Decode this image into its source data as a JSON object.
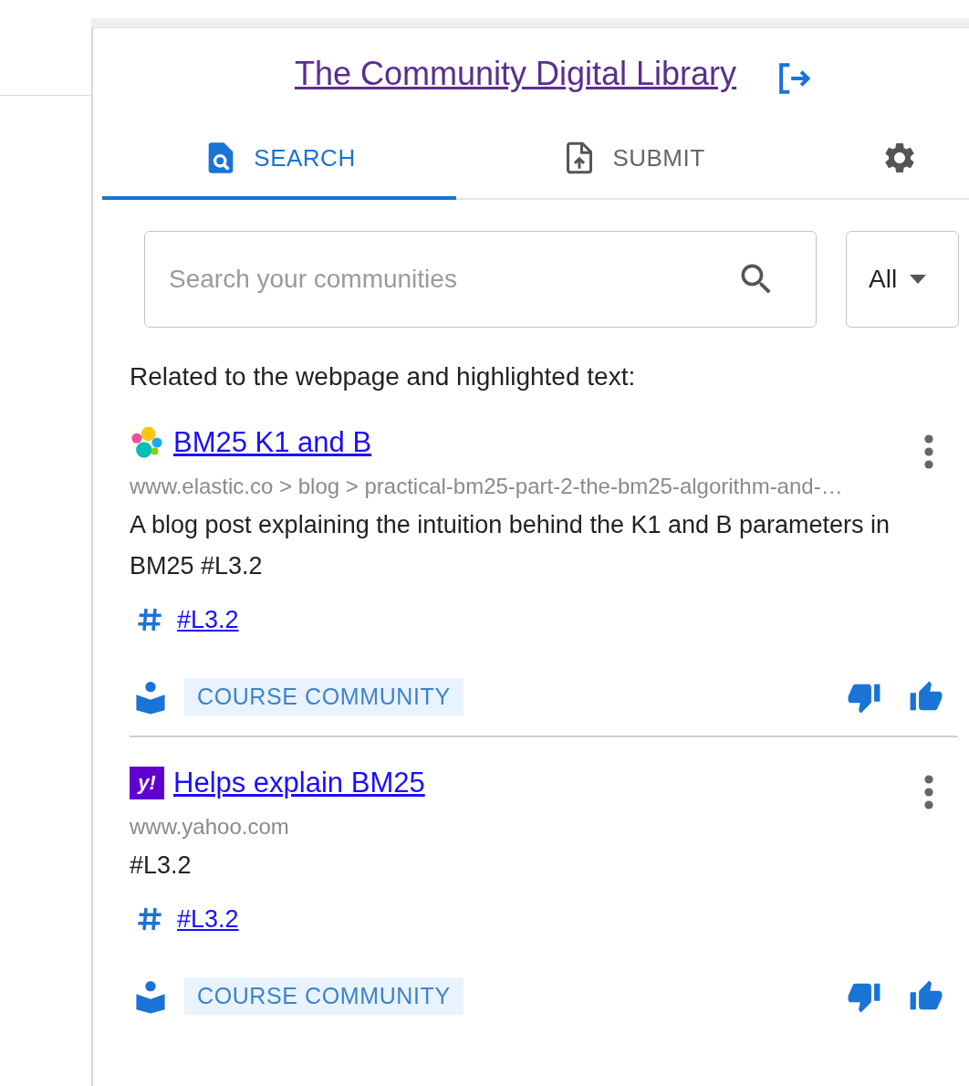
{
  "header": {
    "title": "The Community Digital Library"
  },
  "tabs": [
    {
      "kind": "search",
      "label": "SEARCH",
      "selected": true
    },
    {
      "kind": "submit",
      "label": "SUBMIT",
      "selected": false
    },
    {
      "kind": "settings",
      "selected": false
    }
  ],
  "search": {
    "placeholder": "Search your communities",
    "scope": "All"
  },
  "section_heading": "Related to the webpage and highlighted text:",
  "results": [
    {
      "favicon": {
        "kind": "elastic"
      },
      "title": "BM25 K1 and B",
      "url": "www.elastic.co > blog > practical-bm25-part-2-the-bm25-algorithm-and-…",
      "description": "A blog post explaining the intuition behind the K1 and B parameters in BM25 #L3.2",
      "tags": [
        "#L3.2"
      ],
      "community": "COURSE COMMUNITY"
    },
    {
      "favicon": {
        "kind": "yahoo",
        "text": "y!"
      },
      "title": "Helps explain BM25",
      "url": "www.yahoo.com",
      "description": "#L3.2",
      "tags": [
        "#L3.2"
      ],
      "community": "COURSE COMMUNITY"
    }
  ]
}
